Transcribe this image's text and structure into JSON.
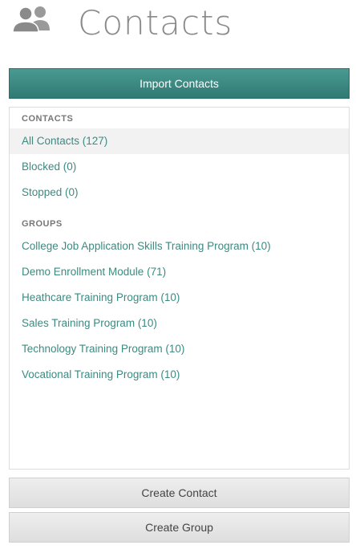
{
  "header": {
    "title": "Contacts",
    "icon": "users-icon"
  },
  "import_button": {
    "label": "Import Contacts"
  },
  "contacts_section": {
    "heading": "CONTACTS",
    "items": [
      {
        "label": "All Contacts (127)",
        "active": true
      },
      {
        "label": "Blocked (0)",
        "active": false
      },
      {
        "label": "Stopped (0)",
        "active": false
      }
    ]
  },
  "groups_section": {
    "heading": "GROUPS",
    "items": [
      {
        "label": "College Job Application Skills Training Program (10)"
      },
      {
        "label": "Demo Enrollment Module (71)"
      },
      {
        "label": "Heathcare Training Program (10)"
      },
      {
        "label": "Sales Training Program (10)"
      },
      {
        "label": "Technology Training Program (10)"
      },
      {
        "label": "Vocational Training Program (10)"
      }
    ]
  },
  "actions": {
    "create_contact": "Create Contact",
    "create_group": "Create Group"
  },
  "colors": {
    "accent": "#3d8a82",
    "import_button": "#2f7a73",
    "title": "#8a8a8a"
  }
}
